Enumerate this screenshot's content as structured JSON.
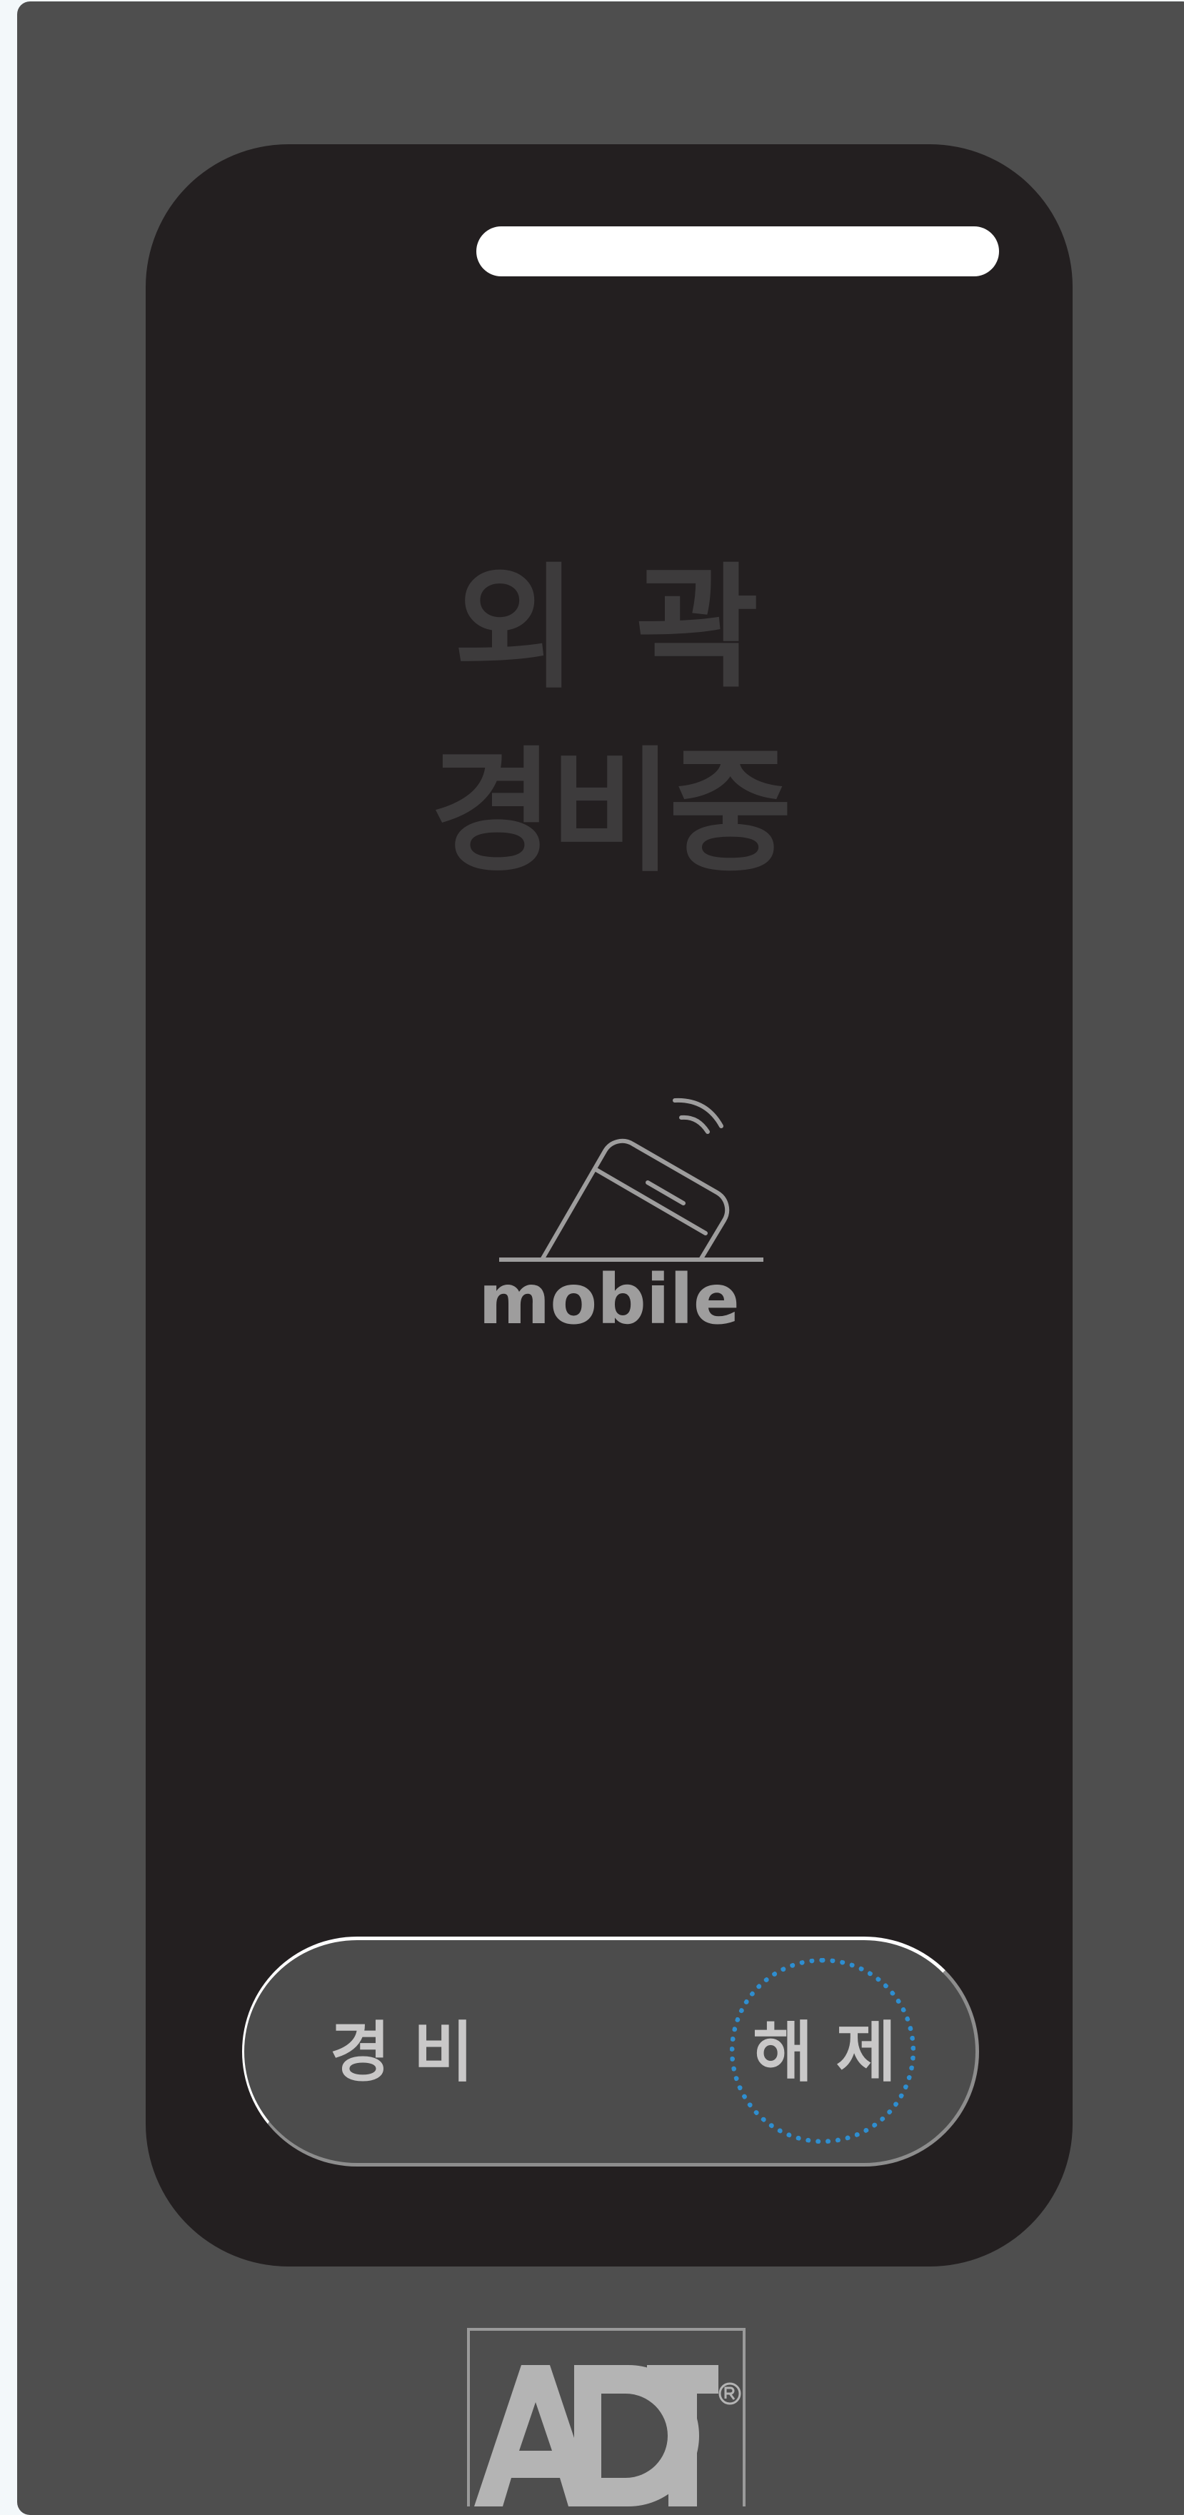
{
  "status": {
    "line1": "외 곽",
    "line2": "경비중",
    "text_color": "#3d3b3c"
  },
  "mode": {
    "icon": "mobile-phone-icon",
    "label": "mobile"
  },
  "arm_switch": {
    "arm_label": "경 비",
    "disarm_label": "해 제",
    "selected": "disarm",
    "highlight_color": "#2e8ed0"
  },
  "brand": {
    "logo_text": "ADT",
    "registered_mark": "®"
  },
  "colors": {
    "device_body": "#4e4e4e",
    "screen": "#231f20",
    "switch_track": "#4c4c4c",
    "icon_stroke": "#9e9d9d"
  }
}
